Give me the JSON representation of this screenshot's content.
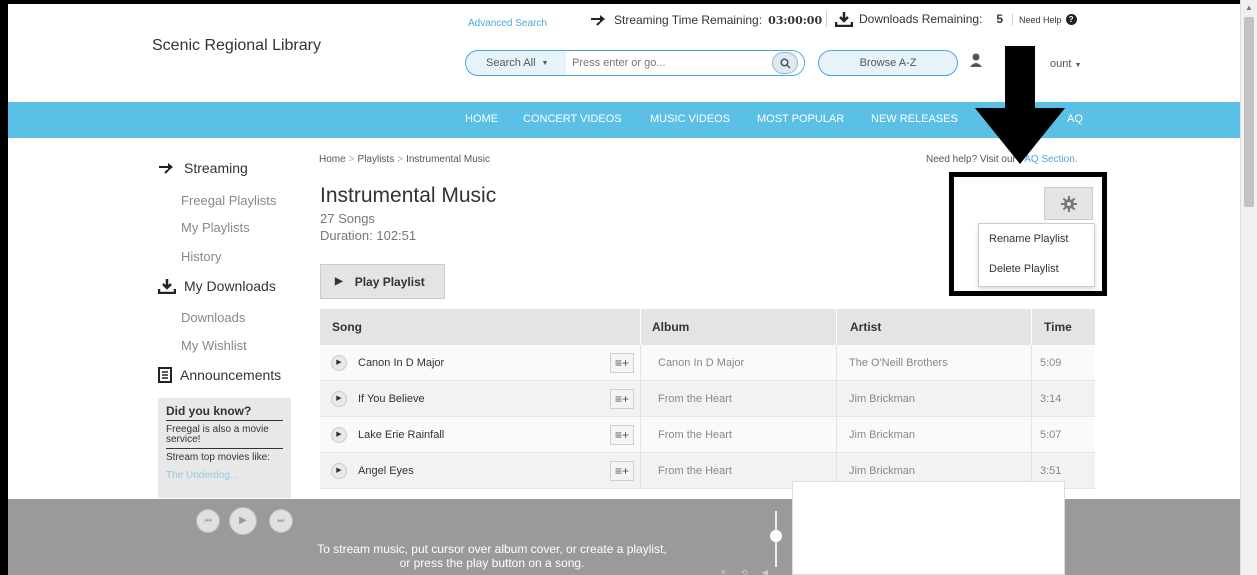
{
  "header": {
    "brand": "Scenic Regional Library",
    "advanced_search": "Advanced Search",
    "streaming_label": "Streaming Time Remaining:",
    "streaming_value": "03:00:00",
    "downloads_label": "Downloads Remaining:",
    "downloads_value": "5",
    "need_help": "Need Help",
    "search_scope": "Search All",
    "search_placeholder": "Press enter or go...",
    "browse": "Browse A-Z",
    "account": "ount"
  },
  "nav": [
    "HOME",
    "CONCERT VIDEOS",
    "MUSIC VIDEOS",
    "MOST POPULAR",
    "NEW RELEASES",
    "AQ"
  ],
  "sidebar": {
    "streaming": "Streaming",
    "streaming_items": [
      "Freegal Playlists",
      "My Playlists",
      "History"
    ],
    "downloads": "My Downloads",
    "downloads_items": [
      "Downloads",
      "My Wishlist"
    ],
    "announcements": "Announcements",
    "did_you_know": "Did you know?",
    "dyk_text1": "Freegal is also a movie service!",
    "dyk_text2": "Stream top movies like:",
    "dyk_text3": "The Underdog..."
  },
  "main": {
    "breadcrumb": [
      "Home",
      "Playlists",
      "Instrumental Music"
    ],
    "help_text": "Need help? Visit our",
    "help_link": "FAQ Section.",
    "title": "Instrumental Music",
    "songs": "27 Songs",
    "duration": "Duration: 102:51",
    "play_playlist": "Play Playlist"
  },
  "menu": {
    "rename": "Rename Playlist",
    "delete": "Delete Playlist"
  },
  "table": {
    "headers": [
      "Song",
      "Album",
      "Artist",
      "Time"
    ],
    "rows": [
      {
        "song": "Canon In D Major",
        "album": "Canon In D Major",
        "artist": "The O'Neill Brothers",
        "time": "5:09"
      },
      {
        "song": "If You Believe",
        "album": "From the Heart",
        "artist": "Jim Brickman",
        "time": "3:14"
      },
      {
        "song": "Lake Erie Rainfall",
        "album": "From the Heart",
        "artist": "Jim Brickman",
        "time": "5:07"
      },
      {
        "song": "Angel Eyes",
        "album": "From the Heart",
        "artist": "Jim Brickman",
        "time": "3:51"
      }
    ]
  },
  "player": {
    "message_line1": "To stream music, put cursor over album cover, or create a playlist,",
    "message_line2": "or press the play button on a song."
  },
  "colors": {
    "nav_bg": "#5bc0e6",
    "accent": "#4aa8d8",
    "player_bg": "#9a9a9a"
  }
}
